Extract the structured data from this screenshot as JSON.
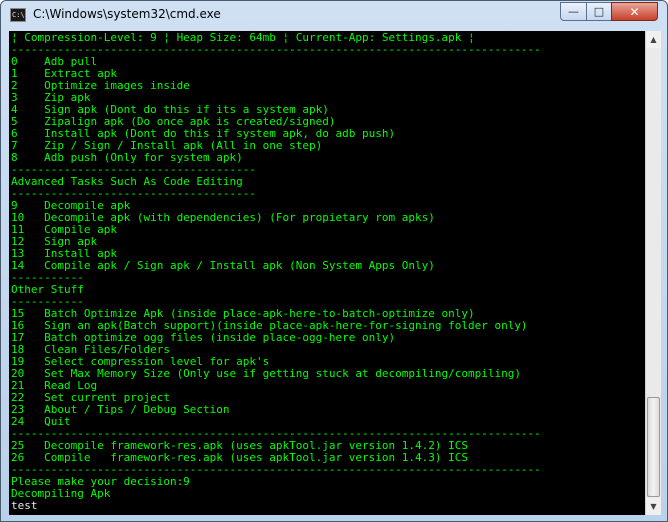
{
  "window": {
    "title": "C:\\Windows\\system32\\cmd.exe",
    "icon_text": "C:\\",
    "buttons": {
      "minimize": "—",
      "maximize": "□",
      "close": "✕"
    }
  },
  "console": {
    "lines": [
      {
        "text": "¦ Compression-Level: 9 ¦ Heap Size: 64mb ¦ Current-App: Settings.apk ¦",
        "kind": "header"
      },
      {
        "text": "--------------------------------------------------------------------------------",
        "kind": "rule"
      },
      {
        "text": "0    Adb pull",
        "kind": "option"
      },
      {
        "text": "1    Extract apk",
        "kind": "option"
      },
      {
        "text": "2    Optimize images inside",
        "kind": "option"
      },
      {
        "text": "3    Zip apk",
        "kind": "option"
      },
      {
        "text": "4    Sign apk (Dont do this if its a system apk)",
        "kind": "option"
      },
      {
        "text": "5    Zipalign apk (Do once apk is created/signed)",
        "kind": "option"
      },
      {
        "text": "6    Install apk (Dont do this if system apk, do adb push)",
        "kind": "option"
      },
      {
        "text": "7    Zip / Sign / Install apk (All in one step)",
        "kind": "option"
      },
      {
        "text": "8    Adb push (Only for system apk)",
        "kind": "option"
      },
      {
        "text": "-------------------------------------",
        "kind": "rule"
      },
      {
        "text": "Advanced Tasks Such As Code Editing",
        "kind": "section"
      },
      {
        "text": "-------------------------------------",
        "kind": "rule"
      },
      {
        "text": "9    Decompile apk",
        "kind": "option"
      },
      {
        "text": "10   Decompile apk (with dependencies) (For propietary rom apks)",
        "kind": "option"
      },
      {
        "text": "11   Compile apk",
        "kind": "option"
      },
      {
        "text": "12   Sign apk",
        "kind": "option"
      },
      {
        "text": "13   Install apk",
        "kind": "option"
      },
      {
        "text": "14   Compile apk / Sign apk / Install apk (Non System Apps Only)",
        "kind": "option"
      },
      {
        "text": "-----------",
        "kind": "rule"
      },
      {
        "text": "Other Stuff",
        "kind": "section"
      },
      {
        "text": "-----------",
        "kind": "rule"
      },
      {
        "text": "15   Batch Optimize Apk (inside place-apk-here-to-batch-optimize only)",
        "kind": "option"
      },
      {
        "text": "16   Sign an apk(Batch support)(inside place-apk-here-for-signing folder only)",
        "kind": "option"
      },
      {
        "text": "17   Batch optimize ogg files (inside place-ogg-here only)",
        "kind": "option"
      },
      {
        "text": "18   Clean Files/Folders",
        "kind": "option"
      },
      {
        "text": "19   Select compression level for apk's",
        "kind": "option"
      },
      {
        "text": "20   Set Max Memory Size (Only use if getting stuck at decompiling/compiling)",
        "kind": "option"
      },
      {
        "text": "21   Read Log",
        "kind": "option"
      },
      {
        "text": "22   Set current project",
        "kind": "option"
      },
      {
        "text": "23   About / Tips / Debug Section",
        "kind": "option"
      },
      {
        "text": "24   Quit",
        "kind": "option"
      },
      {
        "text": "--------------------------------------------------------------------------------",
        "kind": "rule"
      },
      {
        "text": "25   Decompile framework-res.apk (uses apkTool.jar version 1.4.2) ICS",
        "kind": "option"
      },
      {
        "text": "26   Compile   framework-res.apk (uses apkTool.jar version 1.4.3) ICS",
        "kind": "option"
      },
      {
        "text": "--------------------------------------------------------------------------------",
        "kind": "rule"
      },
      {
        "text": "Please make your decision:9",
        "kind": "prompt"
      },
      {
        "text": "Decompiling Apk",
        "kind": "output"
      },
      {
        "text": "test",
        "kind": "input"
      }
    ]
  }
}
